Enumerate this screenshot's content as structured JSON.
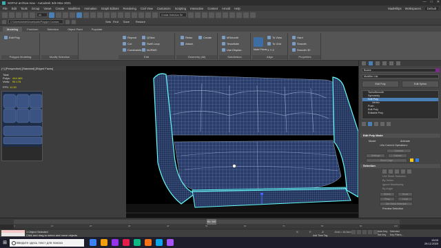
{
  "window": {
    "title": "SOFA2 archive.max - Autodesk 3ds Max 2021",
    "controls": [
      "—",
      "□",
      "✕"
    ]
  },
  "menu": {
    "items": [
      "File",
      "Edit",
      "Tools",
      "Group",
      "Views",
      "Create",
      "Modifiers",
      "Animation",
      "Graph Editors",
      "Rendering",
      "Civil View",
      "Customize",
      "Scripting",
      "Interactive",
      "Content",
      "Arnold",
      "Help"
    ],
    "user": "MadHillips",
    "workspaces_label": "Workspaces:",
    "workspace_value": "Default"
  },
  "toolbar": {
    "selection_filter": "All",
    "named_selection": "Create Selection Se",
    "path": "C:\\Users\\Admin\\Downloads\\Polygon Courses",
    "sets_label": "Sets",
    "find_label": "Find",
    "save_label": "Save",
    "restore_label": "Restore"
  },
  "ribbon": {
    "tabs": [
      "Modeling",
      "Freeform",
      "Selection",
      "Object Paint",
      "Populate"
    ],
    "active_tab": "Modeling",
    "groups": [
      {
        "label": "Polygon Modeling",
        "items": [
          "Edit Poly"
        ]
      },
      {
        "label": "Modify Selection",
        "items": [
          "Repeat",
          "Cut",
          "Constraints",
          "QSlice",
          "Swift Loop",
          "NURMS"
        ]
      },
      {
        "label": "Edit",
        "items": [
          "Relax",
          "Attach",
          "Create",
          "Collapse"
        ]
      },
      {
        "label": "Geometry (All)",
        "items": [
          "MSmooth",
          "Tessellate",
          "Use Displac."
        ]
      },
      {
        "label": "Subdivision",
        "items": [
          "Make Planar",
          "To View",
          "To Grid",
          "X Y Z"
        ]
      },
      {
        "label": "Align",
        "items": [
          "Hard",
          "Smooth",
          "Smooth 30"
        ]
      },
      {
        "label": "Properties",
        "items": []
      }
    ]
  },
  "viewport": {
    "label": "[+] [Perspective] [Standard] [Edged Faces]",
    "stats": [
      {
        "label": "Total",
        "value": ""
      },
      {
        "label": "Polys:",
        "value": "444 469"
      },
      {
        "label": "Verts:",
        "value": "95 178"
      }
    ],
    "fps_label": "FPS:",
    "fps_value": "11.30"
  },
  "command_panel": {
    "object_name": "Boxes",
    "modifier_list": "Modifier List",
    "buttons": [
      "Edit Poly",
      "Edit Spline"
    ],
    "stack": [
      {
        "label": "TurboSmooth",
        "sub": false,
        "selected": false
      },
      {
        "label": "Symmetry",
        "sub": false,
        "selected": false
      },
      {
        "label": "Edit Poly",
        "sub": false,
        "selected": true
      },
      {
        "label": "Vertex",
        "sub": true,
        "selected": false
      },
      {
        "label": "Push",
        "sub": false,
        "selected": false
      },
      {
        "label": "Edit Poly",
        "sub": false,
        "selected": false
      },
      {
        "label": "Editable Poly",
        "sub": false,
        "selected": false
      }
    ],
    "edit_poly_mode": {
      "title": "Edit Poly Mode",
      "model_label": "Model",
      "animate_label": "Animate",
      "current_op": "<No Current Operation>",
      "commit_label": "Commit",
      "settings_label": "Settings",
      "cancel_label": "Cancel",
      "show_cage_label": "Show Cage"
    },
    "selection": {
      "title": "Selection",
      "use_stack": "Use Stack Selection",
      "by_vertex": "By Vertex",
      "ignore_backfacing": "Ignore Backfacing",
      "by_angle": "By Angle",
      "shrink": "Shrink",
      "grow": "Grow",
      "ring": "Ring",
      "loop": "Loop",
      "get_stack": "Get Stack Selection",
      "preview": "Preview Selection"
    }
  },
  "timeline": {
    "slider_label": "90 / 100",
    "ticks": [
      "0",
      "10",
      "20",
      "30",
      "40",
      "50",
      "60",
      "70",
      "80",
      "90",
      "100"
    ]
  },
  "status": {
    "objects_selected": "1 Object Selected",
    "prompt": "Click and drag to select and move objects",
    "x_label": "X:",
    "y_label": "Y:",
    "z_label": "Z:",
    "grid": "Grid = 10,0cm",
    "add_time_tag": "Add Time Tag",
    "auto_key": "Auto Key",
    "set_key": "Set Key",
    "selected": "Selected",
    "key_filters": "Key Filters..."
  },
  "taskbar": {
    "search_placeholder": "Введите здесь текст для поиска",
    "time": "13:03",
    "date": "28.12.2020",
    "app_colors": [
      "#3b82f6",
      "#f59e0b",
      "#9333ea",
      "#e11d48",
      "#10b981",
      "#f97316",
      "#0ea5e9",
      "#a855f7"
    ]
  }
}
